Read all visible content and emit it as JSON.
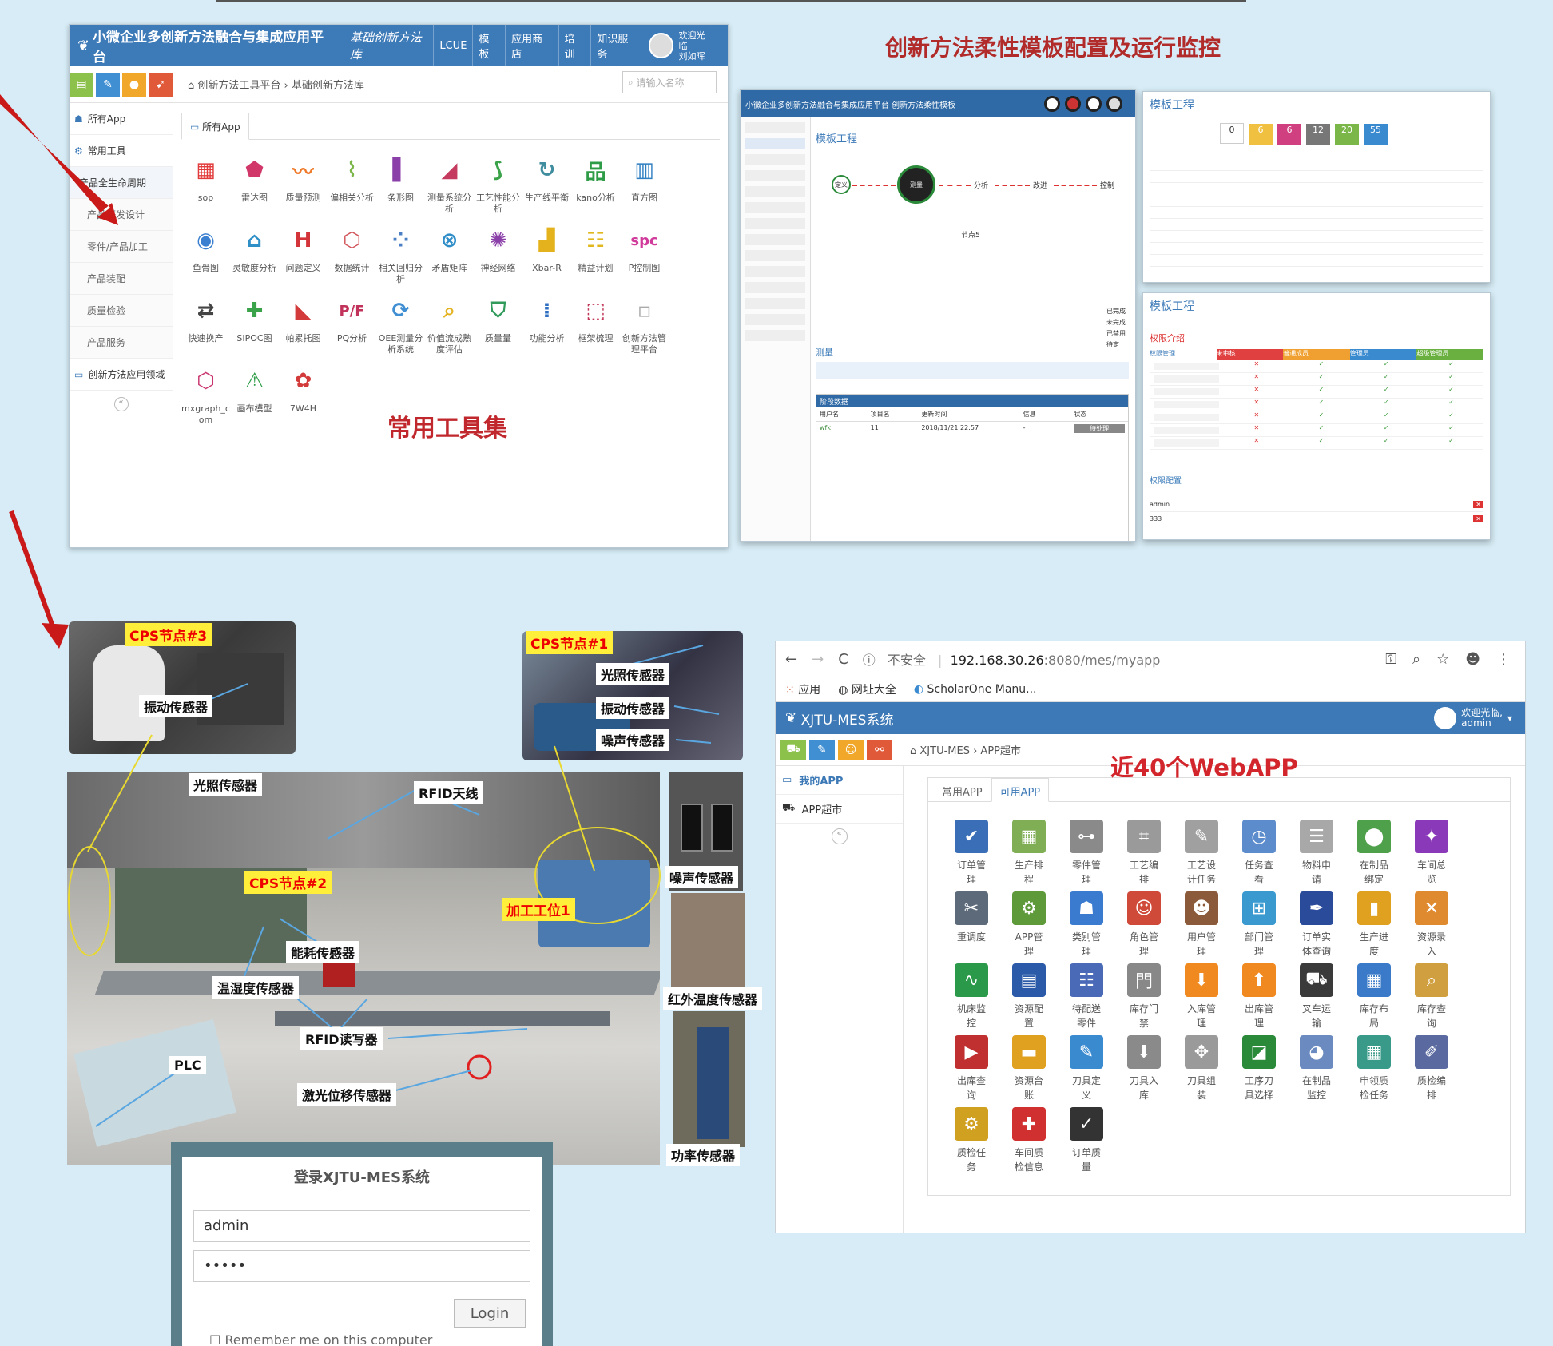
{
  "toolset_panel": {
    "brand": "小微企业多创新方法融合与集成应用平台",
    "subtitle": "基础创新方法库",
    "nav": [
      "LCUE",
      "模板",
      "应用商店",
      "培训",
      "知识服务"
    ],
    "welcome": [
      "欢迎光临",
      "刘如晖"
    ],
    "breadcrumb": "创新方法工具平台 › 基础创新方法库",
    "search_placeholder": "请输入名称",
    "sidebar": [
      {
        "label": "所有App",
        "type": "top"
      },
      {
        "label": "常用工具",
        "type": "top"
      },
      {
        "label": "产品全生命周期",
        "type": "hl"
      },
      {
        "label": "产品研发设计",
        "type": "sub"
      },
      {
        "label": "零件/产品加工",
        "type": "sub"
      },
      {
        "label": "产品装配",
        "type": "sub"
      },
      {
        "label": "质量检验",
        "type": "sub"
      },
      {
        "label": "产品服务",
        "type": "sub"
      },
      {
        "label": "创新方法应用领域",
        "type": "top"
      }
    ],
    "tab": "所有App",
    "apps": [
      {
        "label": "sop",
        "glyph": "▦",
        "color": "#e33b3b"
      },
      {
        "label": "雷达图",
        "glyph": "⬟",
        "color": "#d2376a"
      },
      {
        "label": "质量预测",
        "glyph": "〰",
        "color": "#ef7a2a"
      },
      {
        "label": "偏相关分析",
        "glyph": "⌇",
        "color": "#7ab648"
      },
      {
        "label": "条形图",
        "glyph": "▌",
        "color": "#8b3fa8"
      },
      {
        "label": "测量系统分析",
        "glyph": "◢",
        "color": "#c43b5f"
      },
      {
        "label": "工艺性能分析",
        "glyph": "⟆",
        "color": "#3aa34a"
      },
      {
        "label": "生产线平衡",
        "glyph": "↻",
        "color": "#3f8d9e"
      },
      {
        "label": "kano分析",
        "glyph": "品",
        "color": "#2e9c47"
      },
      {
        "label": "直方图",
        "glyph": "▥",
        "color": "#2f7fc1"
      },
      {
        "label": "鱼骨图",
        "glyph": "◉",
        "color": "#3b7fd0"
      },
      {
        "label": "灵敏度分析",
        "glyph": "⌂",
        "color": "#2f8fc7"
      },
      {
        "label": "问题定义",
        "glyph": "H",
        "color": "#d3343a"
      },
      {
        "label": "数据统计",
        "glyph": "⬡",
        "color": "#d1545a"
      },
      {
        "label": "相关回归分析",
        "glyph": "⁘",
        "color": "#4a7fc6"
      },
      {
        "label": "矛盾矩阵",
        "glyph": "⊗",
        "color": "#2f8ec8"
      },
      {
        "label": "神经网络",
        "glyph": "✺",
        "color": "#8b3fa8"
      },
      {
        "label": "Xbar-R",
        "glyph": "▟",
        "color": "#e4b21c"
      },
      {
        "label": "精益计划",
        "glyph": "☷",
        "color": "#e0b81d"
      },
      {
        "label": "P控制图",
        "glyph": "spc",
        "color": "#d03a9a"
      },
      {
        "label": "快速换产",
        "glyph": "⇄",
        "color": "#444444"
      },
      {
        "label": "SIPOC图",
        "glyph": "✚",
        "color": "#3aa34a"
      },
      {
        "label": "帕累托图",
        "glyph": "◣",
        "color": "#d33a3a"
      },
      {
        "label": "PQ分析",
        "glyph": "P/F",
        "color": "#c2335b"
      },
      {
        "label": "OEE测量分析系统",
        "glyph": "⟳",
        "color": "#3f8fd2"
      },
      {
        "label": "价值流成熟度评估",
        "glyph": "⌕",
        "color": "#e3b21f"
      },
      {
        "label": "质量量",
        "glyph": "⛉",
        "color": "#2f9a5a"
      },
      {
        "label": "功能分析",
        "glyph": "⁞",
        "color": "#2f6fc1"
      },
      {
        "label": "框架梳理",
        "glyph": "⬚",
        "color": "#c03355"
      },
      {
        "label": "创新方法管理平台",
        "glyph": "▫",
        "color": "#aaaaaa"
      },
      {
        "label": "mxgraph_com",
        "glyph": "⬡",
        "color": "#c9356e"
      },
      {
        "label": "画布模型",
        "glyph": "⚠",
        "color": "#2e9c47"
      },
      {
        "label": "7W4H",
        "glyph": "✿",
        "color": "#d33a3a"
      }
    ],
    "caption": "常用工具集"
  },
  "template_panel": {
    "caption": "创新方法柔性模板配置及运行监控",
    "app_title": "小微企业多创新方法融合与集成应用平台  创新方法柔性模板",
    "title": "模板工程",
    "flow_nodes": [
      "定义",
      "测量",
      "分析",
      "改进",
      "控制",
      "节点5"
    ],
    "legend": [
      "已完成",
      "未完成",
      "已禁用",
      "待定"
    ],
    "section_label": "测量",
    "table_title": "阶段数据",
    "table_cols": [
      "用户名",
      "项目名",
      "更新时间",
      "信息",
      "状态"
    ],
    "table_row": [
      "wfk",
      "11",
      "2018/11/21 22:57",
      "-",
      "待处理"
    ],
    "stats": [
      "0",
      "6",
      "6",
      "12",
      "20",
      "55"
    ],
    "perm_title": "权限介绍",
    "perm_cols": [
      "权限管理",
      "未审核",
      "普通成员",
      "管理员",
      "超级管理员"
    ],
    "config_title": "权限配置",
    "config_rows": [
      "admin",
      "333"
    ]
  },
  "photos": {
    "labels": {
      "cps3": "CPS节点#3",
      "vib3": "振动传感器",
      "cps1": "CPS节点#1",
      "light1": "光照传感器",
      "vib1": "振动传感器",
      "noise1": "噪声传感器",
      "light": "光照传感器",
      "rfid_ant": "RFID天线",
      "cps2": "CPS节点#2",
      "station": "加工工位1",
      "energy": "能耗传感器",
      "temp": "温湿度传感器",
      "rfid_rw": "RFID读写器",
      "plc": "PLC",
      "laser": "激光位移传感器",
      "noise": "噪声传感器",
      "ir": "红外温度传感器",
      "power": "功率传感器"
    }
  },
  "login": {
    "title": "登录XJTU-MES系统",
    "username": "admin",
    "password": "•••••",
    "button": "Login",
    "remember": "Remember me on this computer"
  },
  "browser": {
    "not_secure": "不安全",
    "host": "192.168.30.26",
    "path": ":8080/mes/myapp",
    "bookmarks": [
      "应用",
      "网址大全",
      "ScholarOne Manu..."
    ],
    "app_name": "XJTU-MES系统",
    "welcome": [
      "欢迎光临,",
      "admin"
    ],
    "breadcrumb": "XJTU-MES › APP超市",
    "sidebar": [
      "我的APP",
      "APP超市"
    ],
    "tabs": [
      "常用APP",
      "可用APP"
    ],
    "caption": "近40个WebAPP",
    "apps": [
      {
        "label": "订单管理",
        "glyph": "✔",
        "color": "#3a6fb8"
      },
      {
        "label": "生产排程",
        "glyph": "▦",
        "color": "#7fae55"
      },
      {
        "label": "零件管理",
        "glyph": "⊶",
        "color": "#8a8a8a"
      },
      {
        "label": "工艺编排",
        "glyph": "⌗",
        "color": "#9a9a9a"
      },
      {
        "label": "工艺设计任务",
        "glyph": "✎",
        "color": "#a0a0a0"
      },
      {
        "label": "任务查看",
        "glyph": "◷",
        "color": "#5d8ccc"
      },
      {
        "label": "物料申请",
        "glyph": "☰",
        "color": "#a8a8a8"
      },
      {
        "label": "在制品绑定",
        "glyph": "⬤",
        "color": "#4fa04a"
      },
      {
        "label": "车间总览",
        "glyph": "✦",
        "color": "#8a3ab8"
      },
      {
        "label": "重调度",
        "glyph": "✂",
        "color": "#5c6a7a"
      },
      {
        "label": "APP管理",
        "glyph": "⚙",
        "color": "#5e9a3a"
      },
      {
        "label": "类别管理",
        "glyph": "☗",
        "color": "#3a7bd0"
      },
      {
        "label": "角色管理",
        "glyph": "☺",
        "color": "#d04a3a"
      },
      {
        "label": "用户管理",
        "glyph": "☻",
        "color": "#8a5a3a"
      },
      {
        "label": "部门管理",
        "glyph": "⊞",
        "color": "#3a9ad0"
      },
      {
        "label": "订单实体查询",
        "glyph": "✒",
        "color": "#2a4a9a"
      },
      {
        "label": "生产进度",
        "glyph": "▮",
        "color": "#e0a020"
      },
      {
        "label": "资源录入",
        "glyph": "✕",
        "color": "#e08a30"
      },
      {
        "label": "机床监控",
        "glyph": "∿",
        "color": "#2a9a4a"
      },
      {
        "label": "资源配置",
        "glyph": "▤",
        "color": "#2a5aa8"
      },
      {
        "label": "待配送零件",
        "glyph": "☷",
        "color": "#4a6ab8"
      },
      {
        "label": "库存门禁",
        "glyph": "門",
        "color": "#888888"
      },
      {
        "label": "入库管理",
        "glyph": "⬇",
        "color": "#f08a20"
      },
      {
        "label": "出库管理",
        "glyph": "⬆",
        "color": "#f08a20"
      },
      {
        "label": "叉车运输",
        "glyph": "⛟",
        "color": "#3a3a3a"
      },
      {
        "label": "库存布局",
        "glyph": "▦",
        "color": "#3a7ac8"
      },
      {
        "label": "库存查询",
        "glyph": "⌕",
        "color": "#d0a040"
      },
      {
        "label": "出库查询",
        "glyph": "▶",
        "color": "#c03030"
      },
      {
        "label": "资源台账",
        "glyph": "▬",
        "color": "#e0a020"
      },
      {
        "label": "刀具定义",
        "glyph": "✎",
        "color": "#3a8ad0"
      },
      {
        "label": "刀具入库",
        "glyph": "⬇",
        "color": "#8a8a8a"
      },
      {
        "label": "刀具组装",
        "glyph": "✥",
        "color": "#9a9a9a"
      },
      {
        "label": "工序刀具选择",
        "glyph": "◪",
        "color": "#2a8a3a"
      },
      {
        "label": "在制品监控",
        "glyph": "◕",
        "color": "#6a8ac0"
      },
      {
        "label": "申领质检任务",
        "glyph": "▦",
        "color": "#3a9a8a"
      },
      {
        "label": "质检编排",
        "glyph": "✐",
        "color": "#5a6aa0"
      },
      {
        "label": "质检任务",
        "glyph": "⚙",
        "color": "#d0a020"
      },
      {
        "label": "车间质检信息",
        "glyph": "✚",
        "color": "#d03030"
      },
      {
        "label": "订单质量",
        "glyph": "✓",
        "color": "#333333"
      }
    ]
  }
}
